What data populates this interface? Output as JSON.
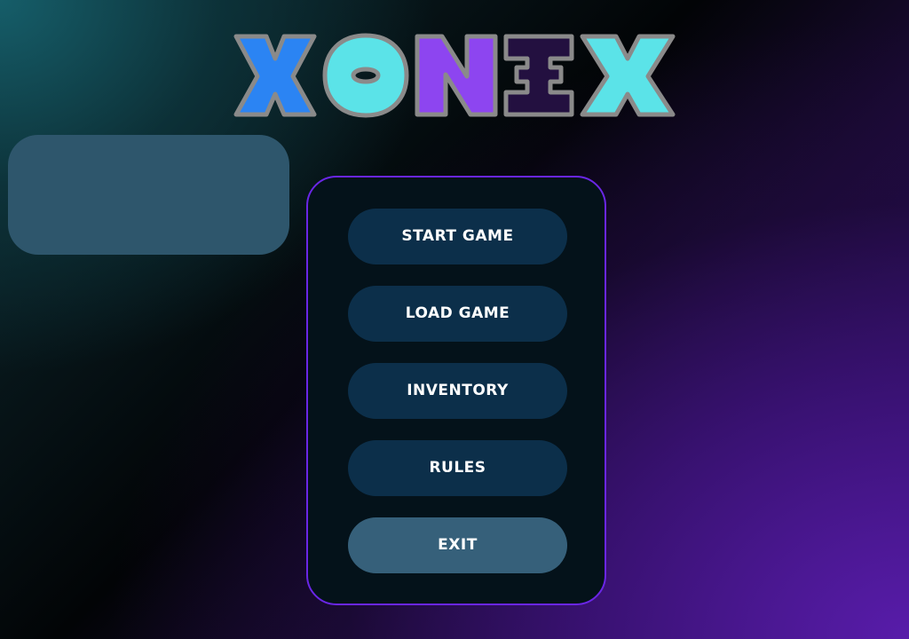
{
  "title": {
    "letters": [
      {
        "char": "X",
        "fill": "#2b84f3"
      },
      {
        "char": "O",
        "fill": "#5be3e8"
      },
      {
        "char": "N",
        "fill": "#8d45f0"
      },
      {
        "char": "I",
        "fill": "#231040"
      },
      {
        "char": "X",
        "fill": "#5be3e8"
      }
    ],
    "outline_color": "#8a8a8a"
  },
  "menu": {
    "start_label": "START GAME",
    "load_label": "LOAD GAME",
    "inventory_label": "INVENTORY",
    "rules_label": "RULES",
    "exit_label": "EXIT"
  },
  "colors": {
    "panel_border": "#6a26e6",
    "button": "#0c2f4a",
    "exit_button": "#36607a",
    "side_panel": "#2e566c"
  }
}
